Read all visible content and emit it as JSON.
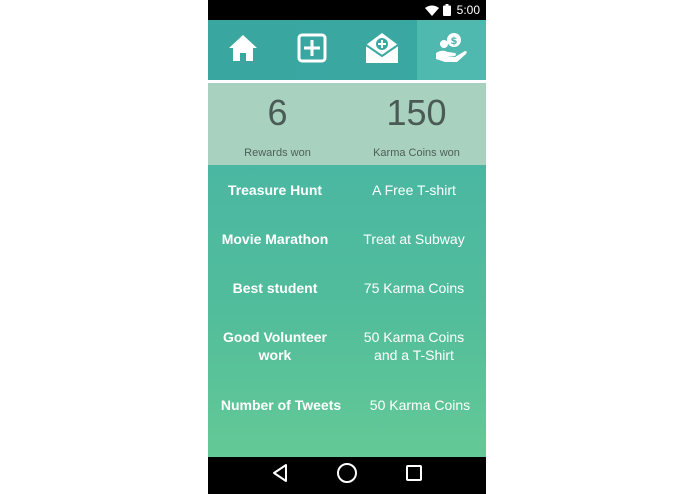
{
  "status_bar": {
    "time": "5:00"
  },
  "nav": {
    "items": [
      {
        "icon": "home-icon",
        "active": false
      },
      {
        "icon": "add-box-icon",
        "active": false
      },
      {
        "icon": "mail-add-icon",
        "active": false
      },
      {
        "icon": "coins-hand-icon",
        "active": true
      }
    ]
  },
  "stats": {
    "rewards_won": {
      "value": "6",
      "label": "Rewards won"
    },
    "coins_won": {
      "value": "150",
      "label": "Karma Coins won"
    }
  },
  "rewards": [
    {
      "name": "Treasure Hunt",
      "prize": "A Free T-shirt"
    },
    {
      "name": "Movie Marathon",
      "prize": "Treat at Subway"
    },
    {
      "name": "Best student",
      "prize": "75 Karma Coins"
    },
    {
      "name": "Good Volunteer work",
      "prize": "50 Karma Coins and a T-Shirt"
    },
    {
      "name": "Number of Tweets",
      "prize": "50 Karma Coins"
    }
  ],
  "colors": {
    "nav_bg": "#3aa9a2",
    "nav_active": "#4fb8af",
    "stats_bg": "#a8d1bf",
    "content_top": "#4ab7a2",
    "content_bottom": "#63c996"
  }
}
